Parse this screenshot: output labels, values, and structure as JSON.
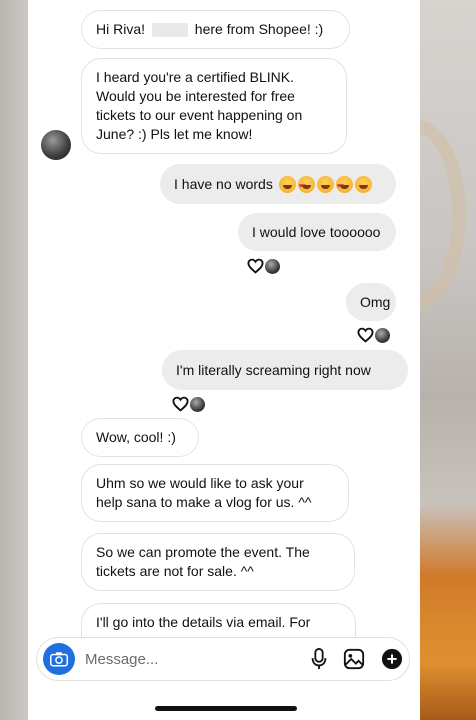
{
  "conversation": {
    "messages": [
      {
        "side": "in",
        "text_before": "Hi Riva!",
        "text_after": "here from Shopee! :)"
      },
      {
        "side": "in",
        "text": "I heard you're a certified BLINK. Would you be interested for free tickets to our event happening on June? :) Pls let me know!"
      },
      {
        "side": "out",
        "text": "I have no words",
        "emoji": [
          "laughing-emoji",
          "heart-eyes-emoji",
          "laughing-emoji",
          "heart-eyes-emoji",
          "laughing-emoji"
        ]
      },
      {
        "side": "out",
        "text": "I would love toooooo"
      },
      {
        "side": "out",
        "text": "Omg"
      },
      {
        "side": "out",
        "text": "I'm literally screaming right now"
      },
      {
        "side": "in",
        "text": "Wow, cool! :)"
      },
      {
        "side": "in",
        "text": "Uhm so we would like to ask your help sana to make a vlog for us. ^^"
      },
      {
        "side": "in",
        "text": "So we can promote the event. The tickets are not for sale. ^^"
      },
      {
        "side": "in",
        "text": "I'll go into the details via email. For"
      }
    ]
  },
  "composer": {
    "placeholder": "Message...",
    "icons": [
      "camera-icon",
      "microphone-icon",
      "gallery-icon",
      "add-icon"
    ],
    "accent": "#1f6fe0"
  }
}
